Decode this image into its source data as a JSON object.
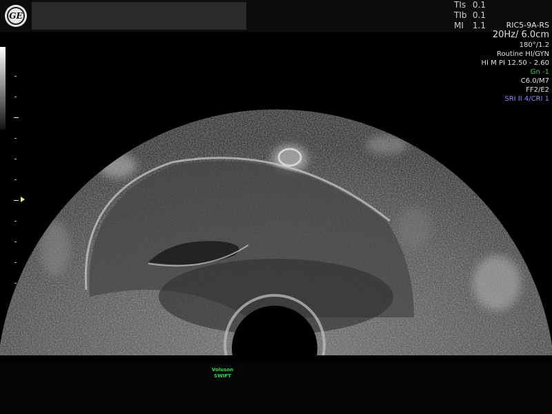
{
  "header": {
    "logo_text": "GE",
    "safety": [
      {
        "label": "TIs",
        "value": "0.1"
      },
      {
        "label": "TIb",
        "value": "0.1"
      },
      {
        "label": "MI",
        "value": "1.1"
      }
    ]
  },
  "params": {
    "probe": "RIC5-9A-RS",
    "frame_depth": "20Hz/ 6.0cm",
    "angle": "180°/1.2",
    "preset": "Routine HI/GYN",
    "harmonics": "HI M PI 12.50 - 2.60",
    "gain": "Gn  -1",
    "map": "C6.0/M7",
    "filter": "FF2/E2",
    "sri": "SRI II 4/CRI 1"
  },
  "colors": {
    "gain_text": "#3fd24a",
    "sri_text": "#8c8cff",
    "brand_text": "#37d44a"
  },
  "footer": {
    "brand_line1": "Voluson",
    "brand_line2": "SWIFT"
  }
}
